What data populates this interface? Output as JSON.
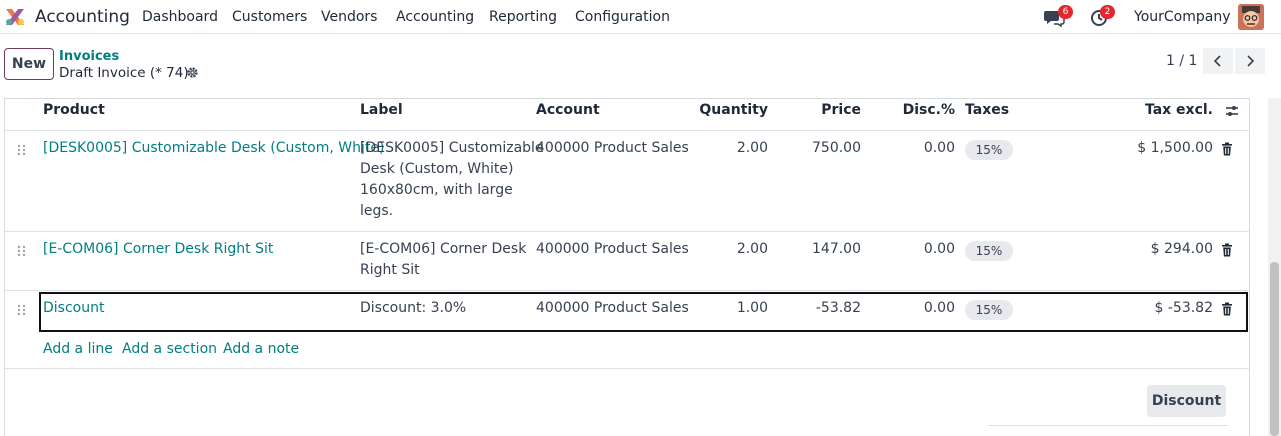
{
  "navbar": {
    "app_name": "Accounting",
    "menu": [
      "Dashboard",
      "Customers",
      "Vendors",
      "Accounting",
      "Reporting",
      "Configuration"
    ],
    "messages_count": "6",
    "activities_count": "2",
    "company": "YourCompany"
  },
  "control": {
    "new_label": "New",
    "breadcrumb_parent": "Invoices",
    "breadcrumb_current": "Draft Invoice (* 74)",
    "pager": "1 / 1"
  },
  "table": {
    "headers": {
      "product": "Product",
      "label": "Label",
      "account": "Account",
      "quantity": "Quantity",
      "price": "Price",
      "disc": "Disc.%",
      "taxes": "Taxes",
      "tax_excl": "Tax excl."
    },
    "rows": [
      {
        "product": "[DESK0005] Customizable Desk (Custom, White)",
        "label_lines": [
          "[DESK0005] Customizable",
          "Desk (Custom, White)",
          "160x80cm, with large",
          "legs."
        ],
        "account": "400000 Product Sales",
        "quantity": "2.00",
        "price": "750.00",
        "disc": "0.00",
        "tax": "15%",
        "subtotal": "$ 1,500.00"
      },
      {
        "product": "[E-COM06] Corner Desk Right Sit",
        "label_lines": [
          "[E-COM06] Corner Desk",
          "Right Sit"
        ],
        "account": "400000 Product Sales",
        "quantity": "2.00",
        "price": "147.00",
        "disc": "0.00",
        "tax": "15%",
        "subtotal": "$ 294.00"
      },
      {
        "product": "Discount",
        "label_lines": [
          "Discount: 3.0%"
        ],
        "account": "400000 Product Sales",
        "quantity": "1.00",
        "price": "-53.82",
        "disc": "0.00",
        "tax": "15%",
        "subtotal": "$ -53.82"
      }
    ],
    "add_line": "Add a line",
    "add_section": "Add a section",
    "add_note": "Add a note"
  },
  "discount_button": "Discount",
  "colors": {
    "link": "#017e84",
    "badge": "#e3262f",
    "brand": "#714b67"
  }
}
